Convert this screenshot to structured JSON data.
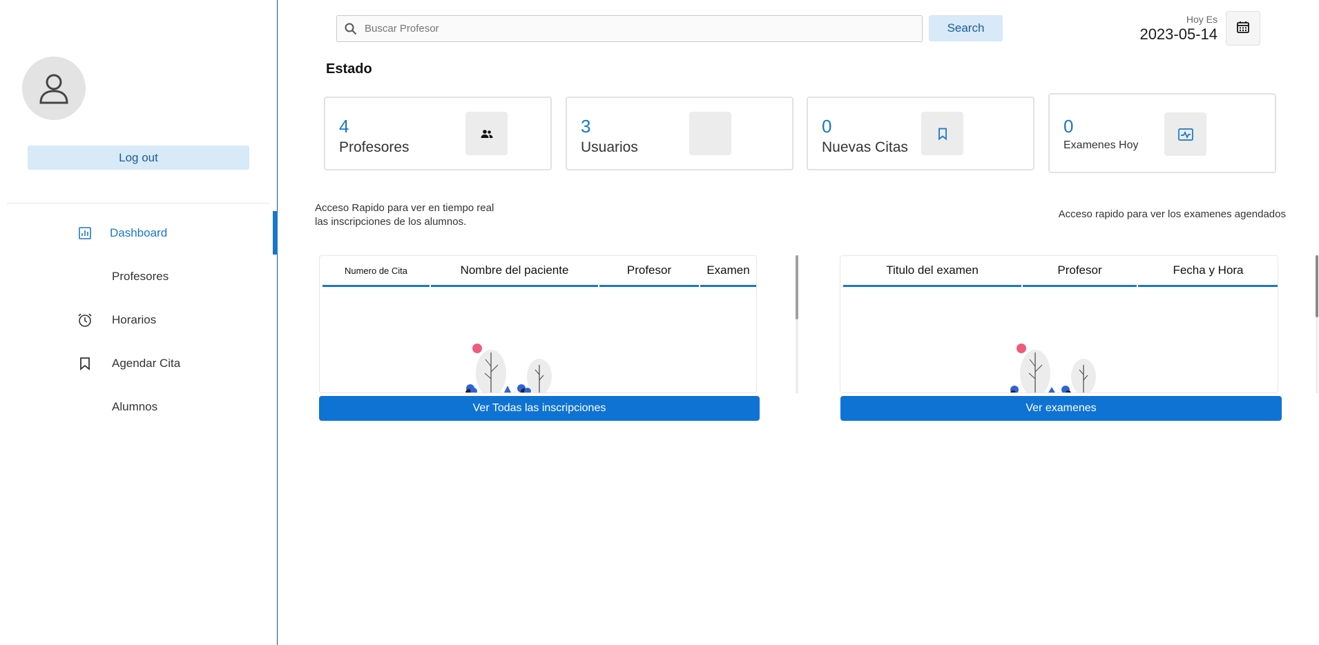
{
  "sidebar": {
    "logout_label": "Log out",
    "items": [
      {
        "label": "Dashboard",
        "icon": "bar-chart-icon",
        "active": true
      },
      {
        "label": "Profesores",
        "icon": "",
        "active": false
      },
      {
        "label": "Horarios",
        "icon": "alarm-clock-icon",
        "active": false
      },
      {
        "label": "Agendar Cita",
        "icon": "bookmark-icon",
        "active": false
      },
      {
        "label": "Alumnos",
        "icon": "",
        "active": false
      }
    ]
  },
  "topbar": {
    "search_placeholder": "Buscar Profesor",
    "search_button": "Search",
    "today_label": "Hoy Es",
    "today_date": "2023-05-14"
  },
  "status": {
    "title": "Estado",
    "cards": [
      {
        "value": "4",
        "label": "Profesores",
        "icon": "people-icon"
      },
      {
        "value": "3",
        "label": "Usuarios",
        "icon": ""
      },
      {
        "value": "0",
        "label": "Nuevas Citas",
        "icon": "bookmark-icon"
      },
      {
        "value": "0",
        "label": "Examenes Hoy",
        "icon": "monitor-pulse-icon"
      }
    ]
  },
  "enrollments": {
    "caption_line1": "Acceso Rapido para ver en tiempo real",
    "caption_line2": "las inscripciones de los alumnos.",
    "columns": [
      "Numero de Cita",
      "Nombre del paciente",
      "Profesor",
      "Examen"
    ],
    "rows": [],
    "button": "Ver Todas las inscripciones"
  },
  "exams": {
    "caption": "Acceso rapido para ver los examenes agendados",
    "columns": [
      "Titulo del examen",
      "Profesor",
      "Fecha y Hora"
    ],
    "rows": [],
    "button": "Ver examenes"
  },
  "colors": {
    "accent": "#1877c9",
    "button_blue": "#0f73d4",
    "light_blue": "#d8e9f8"
  }
}
